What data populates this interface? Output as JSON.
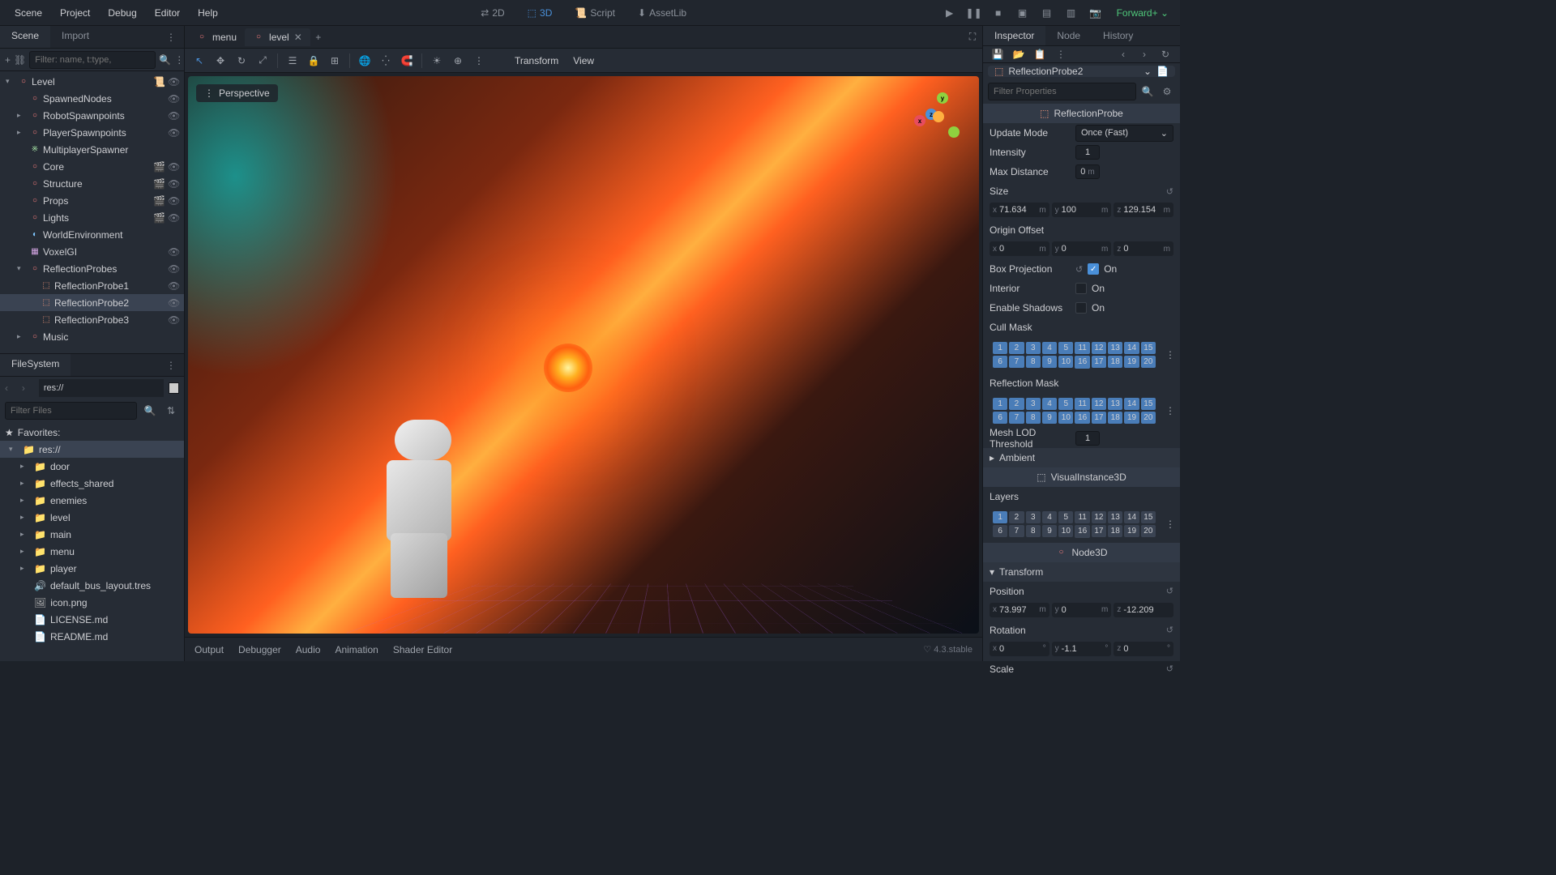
{
  "menubar": {
    "items": [
      "Scene",
      "Project",
      "Debug",
      "Editor",
      "Help"
    ],
    "modes": {
      "m2d": "2D",
      "m3d": "3D",
      "script": "Script",
      "assetlib": "AssetLib"
    },
    "renderer": "Forward+"
  },
  "panels": {
    "scene_tab": "Scene",
    "import_tab": "Import",
    "filesystem_tab": "FileSystem",
    "inspector_tab": "Inspector",
    "node_tab": "Node",
    "history_tab": "History"
  },
  "scene_filter_placeholder": "Filter: name, t:type,",
  "scene_tree": [
    {
      "indent": 0,
      "icon": "node3d",
      "label": "Level",
      "chevron": "▾",
      "right": [
        "script",
        "eye"
      ]
    },
    {
      "indent": 1,
      "icon": "node3d",
      "label": "SpawnedNodes",
      "right": [
        "eye"
      ]
    },
    {
      "indent": 1,
      "icon": "node3d",
      "label": "RobotSpawnpoints",
      "chevron": "▸",
      "right": [
        "eye"
      ]
    },
    {
      "indent": 1,
      "icon": "node3d",
      "label": "PlayerSpawnpoints",
      "chevron": "▸",
      "right": [
        "eye"
      ]
    },
    {
      "indent": 1,
      "icon": "spawner",
      "label": "MultiplayerSpawner"
    },
    {
      "indent": 1,
      "icon": "node3d",
      "label": "Core",
      "right": [
        "film",
        "eye"
      ]
    },
    {
      "indent": 1,
      "icon": "node3d",
      "label": "Structure",
      "right": [
        "film",
        "eye"
      ]
    },
    {
      "indent": 1,
      "icon": "node3d",
      "label": "Props",
      "right": [
        "film",
        "eye"
      ]
    },
    {
      "indent": 1,
      "icon": "node3d",
      "label": "Lights",
      "right": [
        "film",
        "eye"
      ]
    },
    {
      "indent": 1,
      "icon": "env",
      "label": "WorldEnvironment"
    },
    {
      "indent": 1,
      "icon": "gi",
      "label": "VoxelGI",
      "right": [
        "eye"
      ]
    },
    {
      "indent": 1,
      "icon": "node3d",
      "label": "ReflectionProbes",
      "chevron": "▾",
      "right": [
        "eye"
      ]
    },
    {
      "indent": 2,
      "icon": "reflect",
      "label": "ReflectionProbe1",
      "right": [
        "eye"
      ]
    },
    {
      "indent": 2,
      "icon": "reflect",
      "label": "ReflectionProbe2",
      "selected": true,
      "right": [
        "eye"
      ]
    },
    {
      "indent": 2,
      "icon": "reflect",
      "label": "ReflectionProbe3",
      "right": [
        "eye"
      ]
    },
    {
      "indent": 1,
      "icon": "node3d",
      "label": "Music",
      "chevron": "▸"
    }
  ],
  "fs": {
    "path": "res://",
    "filter_placeholder": "Filter Files",
    "favorites_label": "Favorites:",
    "items": [
      {
        "indent": 0,
        "type": "folder",
        "label": "res://",
        "chevron": "▾",
        "selected": true
      },
      {
        "indent": 1,
        "type": "folder",
        "label": "door",
        "chevron": "▸"
      },
      {
        "indent": 1,
        "type": "folder",
        "label": "effects_shared",
        "chevron": "▸"
      },
      {
        "indent": 1,
        "type": "folder",
        "label": "enemies",
        "chevron": "▸"
      },
      {
        "indent": 1,
        "type": "folder",
        "label": "level",
        "chevron": "▸"
      },
      {
        "indent": 1,
        "type": "folder",
        "label": "main",
        "chevron": "▸"
      },
      {
        "indent": 1,
        "type": "folder",
        "label": "menu",
        "chevron": "▸"
      },
      {
        "indent": 1,
        "type": "folder",
        "label": "player",
        "chevron": "▸"
      },
      {
        "indent": 1,
        "type": "file-bus",
        "label": "default_bus_layout.tres"
      },
      {
        "indent": 1,
        "type": "file-img",
        "label": "icon.png"
      },
      {
        "indent": 1,
        "type": "file-md",
        "label": "LICENSE.md"
      },
      {
        "indent": 1,
        "type": "file-md",
        "label": "README.md"
      }
    ]
  },
  "open_scenes": [
    {
      "label": "menu"
    },
    {
      "label": "level",
      "active": true
    }
  ],
  "viewport": {
    "perspective": "Perspective",
    "transform": "Transform",
    "view": "View"
  },
  "bottom_tabs": [
    "Output",
    "Debugger",
    "Audio",
    "Animation",
    "Shader Editor"
  ],
  "version": "4.3.stable",
  "inspector": {
    "node_name": "ReflectionProbe2",
    "filter_placeholder": "Filter Properties",
    "class_header": "ReflectionProbe",
    "props": {
      "update_mode": {
        "label": "Update Mode",
        "value": "Once (Fast)"
      },
      "intensity": {
        "label": "Intensity",
        "value": "1"
      },
      "max_distance": {
        "label": "Max Distance",
        "value": "0",
        "unit": "m"
      },
      "size": {
        "label": "Size",
        "x": "71.634",
        "y": "100",
        "z": "129.154",
        "unit": "m"
      },
      "origin_offset": {
        "label": "Origin Offset",
        "x": "0",
        "y": "0",
        "z": "0",
        "unit": "m"
      },
      "box_projection": {
        "label": "Box Projection",
        "on": "On",
        "checked": true
      },
      "interior": {
        "label": "Interior",
        "on": "On",
        "checked": false
      },
      "enable_shadows": {
        "label": "Enable Shadows",
        "on": "On",
        "checked": false
      },
      "cull_mask": {
        "label": "Cull Mask"
      },
      "reflection_mask": {
        "label": "Reflection Mask"
      },
      "mesh_lod": {
        "label": "Mesh LOD Threshold",
        "value": "1"
      },
      "ambient": {
        "label": "Ambient"
      }
    },
    "visual_instance": "VisualInstance3D",
    "layers": {
      "label": "Layers"
    },
    "node3d": "Node3D",
    "transform": {
      "header": "Transform",
      "position": {
        "label": "Position",
        "x": "73.997",
        "xu": "m",
        "y": "0",
        "yu": "m",
        "z": "-12.209"
      },
      "rotation": {
        "label": "Rotation",
        "x": "0",
        "y": "-1.1",
        "z": "0",
        "unit": "°"
      },
      "scale": {
        "label": "Scale"
      }
    }
  },
  "layer_nums": [
    "1",
    "2",
    "3",
    "4",
    "5",
    "11",
    "12",
    "13",
    "14",
    "15",
    "6",
    "7",
    "8",
    "9",
    "10",
    "16",
    "17",
    "18",
    "19",
    "20"
  ]
}
